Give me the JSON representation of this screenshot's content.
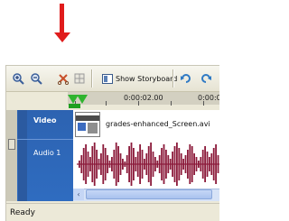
{
  "toolbar": {
    "zoom_in_icon": "magnifier-plus",
    "zoom_out_icon": "magnifier-minus",
    "delete_icon": "scissors-x",
    "storyboard_label": "Show Storyboard",
    "undo_icon": "undo-arrow",
    "redo_icon": "redo-arrow"
  },
  "ruler": {
    "labels": [
      "0:00:02.00",
      "0:00:0"
    ]
  },
  "timeline": {
    "video_label": "Video",
    "audio_label": "Audio 1",
    "clip_name": "grades-enhanced_Screen.avi"
  },
  "scrollbar": {
    "left_arrow": "‹"
  },
  "status": {
    "text": "Ready"
  },
  "colors": {
    "annotation_arrow": "#e01c1c",
    "track_header": "#2f6cc0",
    "waveform": "#8b1a3a",
    "playhead": "#2fb42f"
  }
}
